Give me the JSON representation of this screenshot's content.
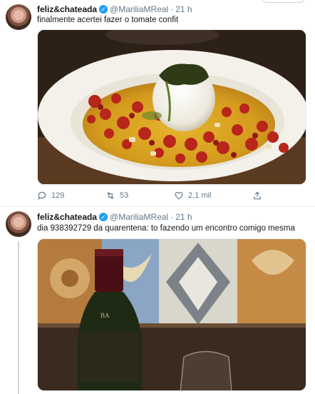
{
  "tweets": [
    {
      "author": {
        "name": "feliz&chateada",
        "handle": "@MariliaMReal",
        "verified": true
      },
      "time": "21 h",
      "separator": "·",
      "text": "finalmente acertei fazer o tomate confit",
      "media": {
        "alt_icon": "photo-food"
      },
      "actions": {
        "replies": "129",
        "retweets": "53",
        "likes": "2,1 mil"
      }
    },
    {
      "author": {
        "name": "feliz&chateada",
        "handle": "@MariliaMReal",
        "verified": true
      },
      "time": "21 h",
      "separator": "·",
      "text": "dia 938392729 da quarentena: to fazendo um encontro comigo mesma",
      "media": {
        "alt_icon": "photo-wine"
      }
    }
  ],
  "colors": {
    "accent": "#1da1f2",
    "muted": "#657786",
    "divider": "#e6ecf0"
  }
}
